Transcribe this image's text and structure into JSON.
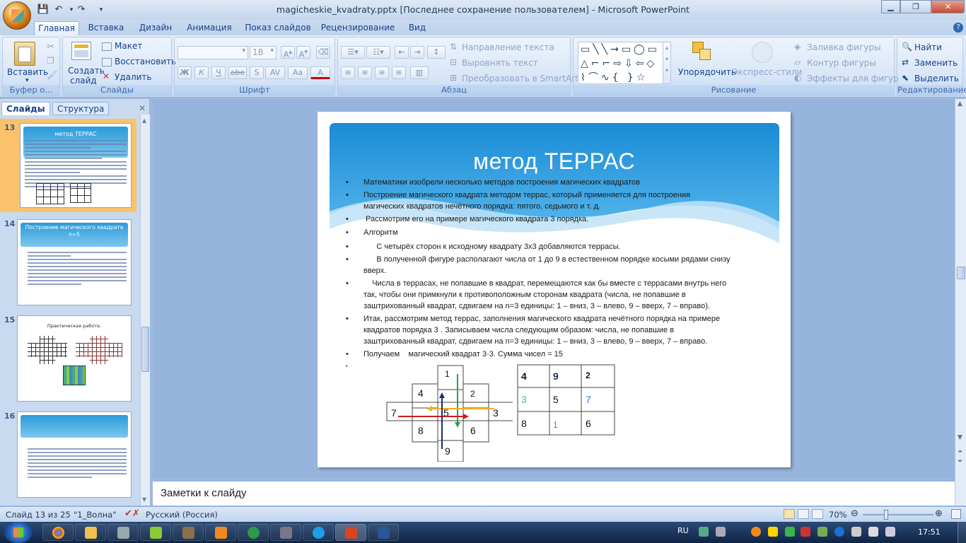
{
  "window": {
    "title": "magicheskie_kvadraty.pptx [Последнее сохранение пользователем] - Microsoft PowerPoint"
  },
  "tabs": [
    "Главная",
    "Вставка",
    "Дизайн",
    "Анимация",
    "Показ слайдов",
    "Рецензирование",
    "Вид"
  ],
  "ribbon": {
    "clipboard": {
      "paste": "Вставить",
      "label": "Буфер о..."
    },
    "slides": {
      "new_slide_1": "Создать",
      "new_slide_2": "слайд",
      "layout": "Макет",
      "reset": "Восстановить",
      "delete": "Удалить",
      "label": "Слайды"
    },
    "font": {
      "size": "18",
      "bold": "Ж",
      "italic": "К",
      "underline": "Ч",
      "strike": "abe",
      "shadow": "S",
      "spacing": "AV",
      "case": "Aa",
      "color": "A",
      "label": "Шрифт"
    },
    "paragraph": {
      "text_dir": "Направление текста",
      "align_text": "Выровнять текст",
      "smartart": "Преобразовать в SmartArt",
      "label": "Абзац"
    },
    "drawing": {
      "arrange": "Упорядочить",
      "quick_styles": "Экспресс-стили",
      "fill": "Заливка фигуры",
      "outline": "Контур фигуры",
      "effects": "Эффекты для фигур",
      "label": "Рисование"
    },
    "editing": {
      "find": "Найти",
      "replace": "Заменить",
      "select": "Выделить",
      "label": "Редактирование"
    }
  },
  "left_pane": {
    "tab_slides": "Слайды",
    "tab_outline": "Структура",
    "thumbs": [
      {
        "num": "13",
        "title": "метод ТЕРРАС"
      },
      {
        "num": "14",
        "title": "Построение магического квадрата n=5"
      },
      {
        "num": "15",
        "title": "Практическая  работа."
      },
      {
        "num": "16",
        "title": ""
      }
    ]
  },
  "slide": {
    "title": "метод ТЕРРАС",
    "bullets": [
      "Математики изобрели несколько методов построения магических квадратов",
      "Построение магического квадрата методом террас, который применяется для построения",
      "магических квадратов нечётного порядка: пятого, седьмого и т. д.",
      " Рассмотрим его на примере магического квадрата 3 порядка.",
      "Алгоритм",
      "      С четырёх сторон к исходному квадрату 3х3 добавляются террасы.",
      "      В полученной фигуре располагают числа от 1 до 9 в естественном порядке косыми рядами снизу",
      "вверх.",
      "    Числа в террасах, не попавшие в квадрат, перемещаются как бы вместе с террасами внутрь него",
      "так, чтобы они примкнули к противоположным сторонам квадрата (числа, не попавшие в",
      "заштрихованный квадрат, сдвигаем на n=3 единицы: 1 – вниз, 3 – влево, 9 – вверх, 7 – вправо).",
      "Итак, рассмотрим метод террас, заполнения магического квадрата нечётного порядка на примере",
      "квадратов порядка 3 . Записываем числа следующим образом: числа, не попавшие в",
      "заштрихованный квадрат, сдвигаем на n=3 единицы: 1 – вниз, 3 – влево, 9 – вверх, 7 – вправо.",
      "Получаем    магический квадрат 3·3. Сумма чисел = 15"
    ],
    "terrace": {
      "top": "1",
      "a": "4",
      "b": "2",
      "left": "7",
      "center": "5",
      "right": "3",
      "c": "8",
      "d": "6",
      "bottom": "9"
    },
    "magic": [
      [
        "4",
        "9",
        "2"
      ],
      [
        "3",
        "5",
        "7"
      ],
      [
        "8",
        "1",
        "6"
      ]
    ],
    "colors": {
      "accent": "#2b9ad9",
      "arrow_green": "#2aa44a",
      "arrow_orange": "#f0b020",
      "arrow_red": "#c81e1e",
      "arrow_navy": "#1c2f6a",
      "teal": "#3ab5c8"
    }
  },
  "notes": "Заметки к слайду",
  "status": {
    "slide": "Слайд 13 из 25",
    "theme": "\"1_Волна\"",
    "lang": "Русский (Россия)",
    "zoom": "70%"
  },
  "taskbar": {
    "lang": "RU",
    "time": "17:51"
  }
}
